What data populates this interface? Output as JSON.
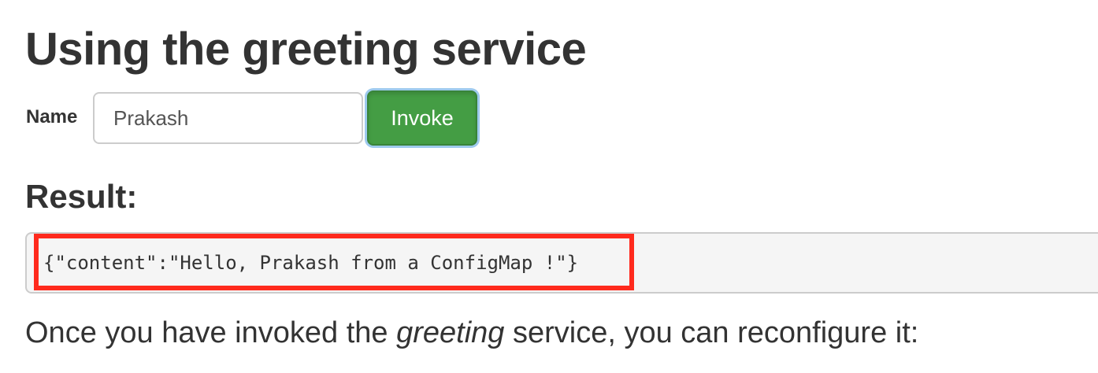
{
  "page": {
    "title": "Using the greeting service"
  },
  "form": {
    "name_label": "Name",
    "name_value": "Prakash",
    "invoke_label": "Invoke"
  },
  "result": {
    "heading": "Result:",
    "text": "{\"content\":\"Hello, Prakash from a ConfigMap !\"}",
    "highlight_color": "#ff2a1d"
  },
  "instruction": {
    "before": "Once you have invoked the ",
    "emphasis": "greeting",
    "after": " service, you can reconfigure it:"
  },
  "colors": {
    "button_green": "#449d44",
    "focus_ring": "#9ecaed",
    "pre_background": "#f5f5f5",
    "text": "#333333"
  }
}
